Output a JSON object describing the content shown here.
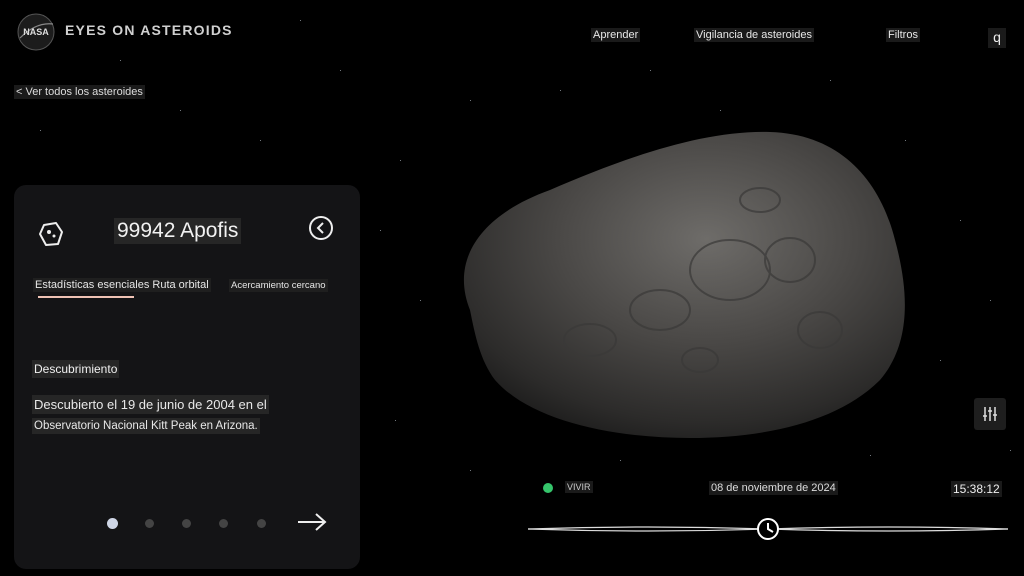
{
  "header": {
    "logo_text": "NASA",
    "brand": "EYES ON ASTEROIDS",
    "nav": [
      {
        "label": "Aprender"
      },
      {
        "label": "Vigilancia de asteroides"
      },
      {
        "label": "Filtros"
      }
    ],
    "search_label": "q"
  },
  "back_link": "< Ver todos los asteroides",
  "panel": {
    "title": "99942 Apofis",
    "tabs": [
      {
        "label": "Estadísticas esenciales Ruta orbital",
        "active": true
      },
      {
        "label": "Acercamiento cercano",
        "active": false
      }
    ],
    "section_heading": "Descubrimiento",
    "description_line1": "Descubierto el 19 de junio de 2004 en el",
    "description_line2": "Observatorio Nacional Kitt Peak en Arizona.",
    "pagination": {
      "total": 5,
      "current": 1
    }
  },
  "status": {
    "live_label": "VIVIR",
    "date": "08 de noviembre de 2024",
    "time": "15:38:12"
  },
  "colors": {
    "accent_underline": "#f0c3b5",
    "live_green": "#35c56b",
    "panel_bg": "#141416"
  }
}
